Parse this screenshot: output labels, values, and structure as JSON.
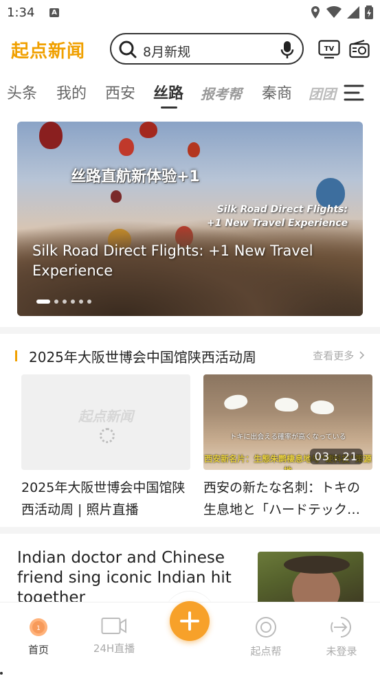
{
  "status_bar": {
    "time": "1:34",
    "a_badge": "A"
  },
  "header": {
    "logo_text": "起点新闻",
    "search_text": "8月新规",
    "tv_label": "TV"
  },
  "tabs": [
    {
      "label": "头条"
    },
    {
      "label": "我的"
    },
    {
      "label": "西安"
    },
    {
      "label": "丝路",
      "active": true
    },
    {
      "label": "报考帮"
    },
    {
      "label": "秦商"
    },
    {
      "label": "团团"
    }
  ],
  "banner": {
    "overlay_title": "丝路直航新体验+1",
    "overlay_en_line1": "Silk Road Direct Flights:",
    "overlay_en_line2": "+1 New Travel Experience",
    "caption": "Silk Road Direct Flights: +1 New Travel Experience",
    "slides_total": 6,
    "slide_active": 1
  },
  "section": {
    "title": "2025年大阪世博会中国馆陕西活动周",
    "more_label": "查看更多",
    "cards": [
      {
        "title": "2025年大阪世博会中国馆陕西活动周 | 照片直播",
        "placeholder_text": "起点新闻"
      },
      {
        "title": "西安の新たな名刺：トキの生息地と「ハードテック…",
        "duration": "03 : 21",
        "subtitle_jp": "トキに出会える確率が高くなっている",
        "subtitle_cn": "西安新名片：生態朱鹮棲息地与“硬科技”策源地"
      }
    ]
  },
  "news_item": {
    "title": "Indian doctor and Chinese friend sing iconic Indian hit together"
  },
  "bottom_nav": {
    "items": [
      {
        "label": "首页",
        "active": true
      },
      {
        "label": "24H直播"
      },
      {
        "label": "起点帮"
      },
      {
        "label": "未登录"
      }
    ]
  },
  "colors": {
    "accent": "#f0a000",
    "fab": "#f7a12a"
  }
}
